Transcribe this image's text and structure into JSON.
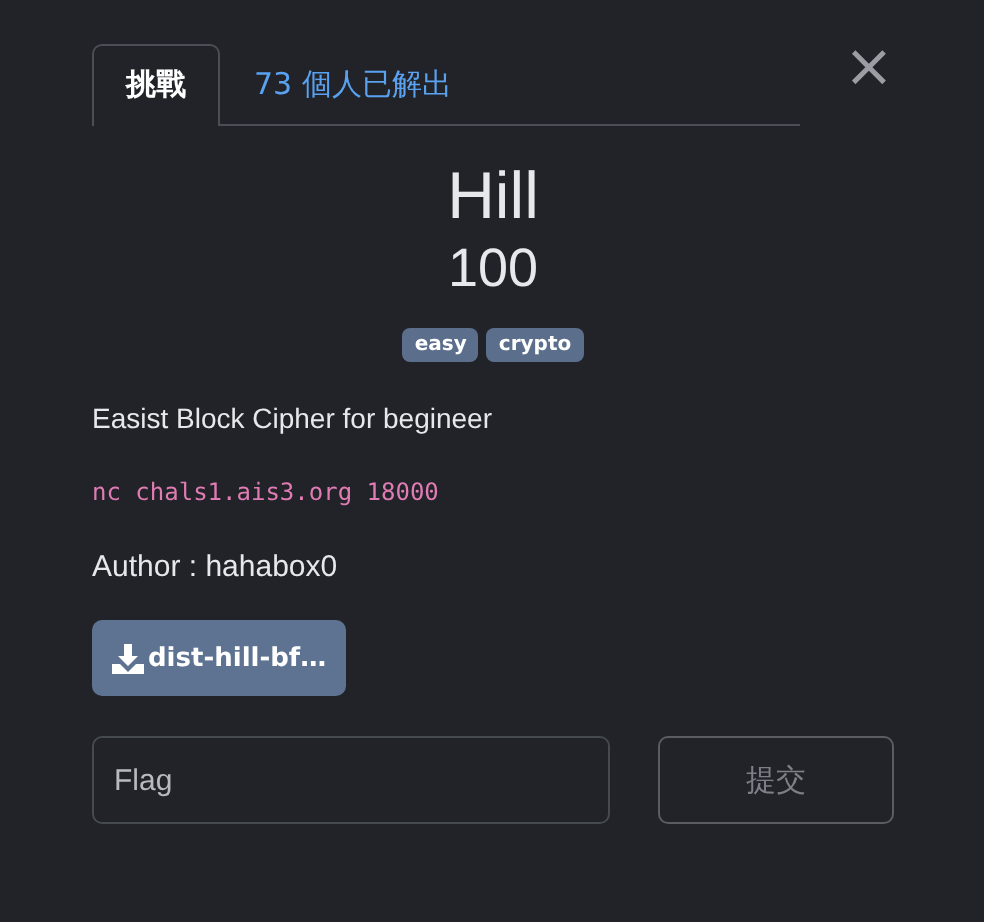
{
  "tabs": [
    {
      "label": "挑戰",
      "selected": true
    },
    {
      "label": "73 個人已解出",
      "selected": false
    }
  ],
  "close": {
    "label": "×"
  },
  "challenge": {
    "name": "Hill",
    "points": "100",
    "tags": [
      "easy",
      "crypto"
    ],
    "description": "Easist Block Cipher for begineer",
    "command": "nc chals1.ais3.org 18000",
    "author": "Author : hahabox0",
    "files": [
      {
        "label": "dist-hill-bf…"
      }
    ]
  },
  "flag_input": {
    "placeholder": "Flag"
  },
  "submit": {
    "label": "提交",
    "disabled": true
  }
}
